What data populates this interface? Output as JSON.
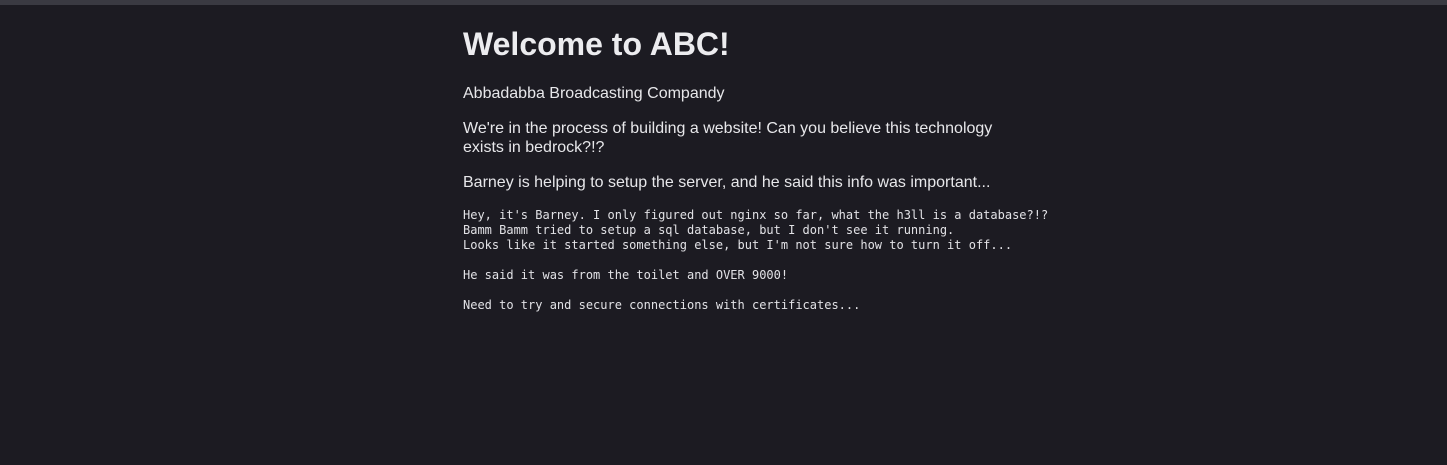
{
  "page": {
    "heading": "Welcome to ABC!",
    "tagline": "Abbadabba Broadcasting Compandy",
    "intro": "We're in the process of building a website! Can you believe this technology exists in bedrock?!?",
    "note_intro": "Barney is helping to setup the server, and he said this info was important...",
    "note_preformatted": "Hey, it's Barney. I only figured out nginx so far, what the h3ll is a database?!?\nBamm Bamm tried to setup a sql database, but I don't see it running.\nLooks like it started something else, but I'm not sure how to turn it off...\n\nHe said it was from the toilet and OVER 9000!\n\nNeed to try and secure connections with certificates..."
  },
  "colors": {
    "background": "#1c1b22",
    "text": "#e9e9ec",
    "top_strip": "#3a3a42"
  }
}
